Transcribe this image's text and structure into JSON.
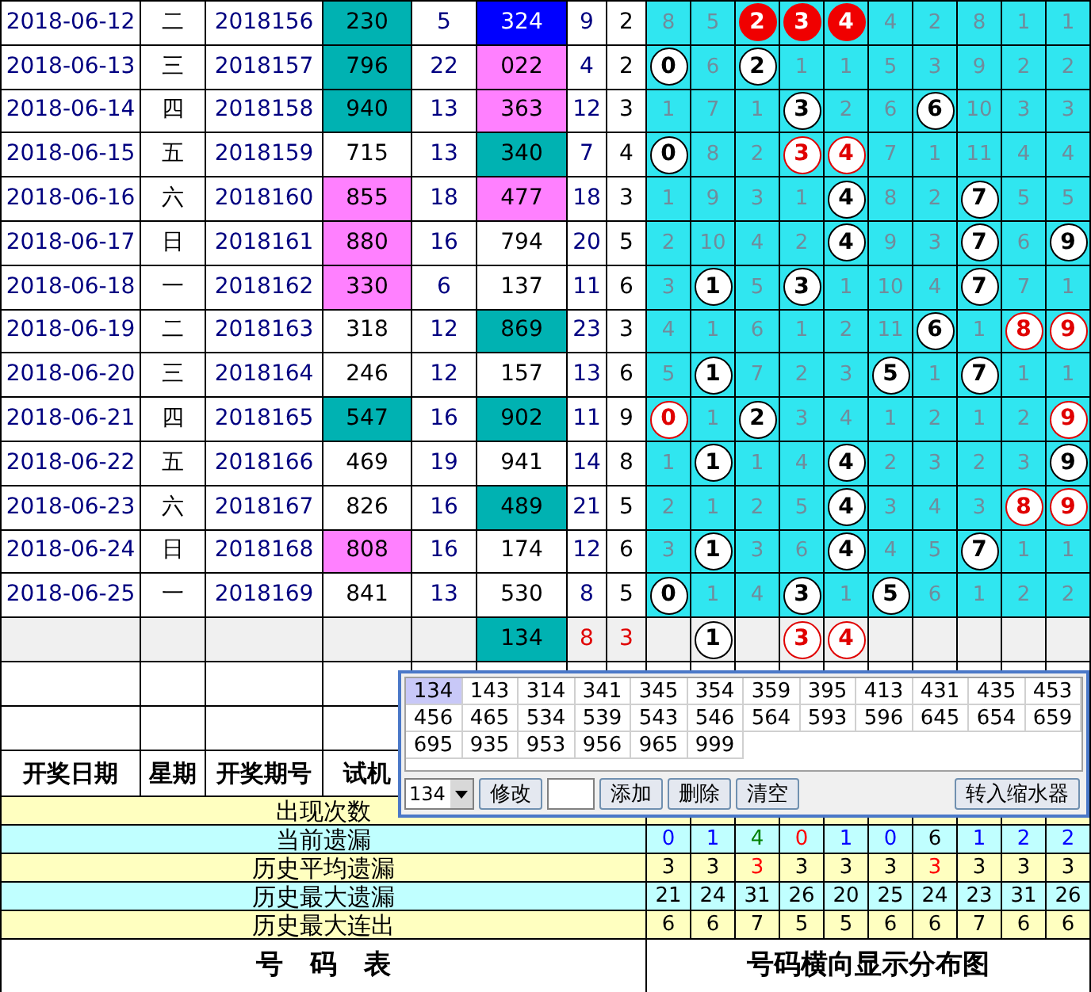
{
  "rows": [
    {
      "date": "2018-06-12",
      "weekday": "二",
      "issue": "2018156",
      "trial": {
        "value": "230",
        "color": "#00b2b2"
      },
      "sum": "5",
      "drawn": {
        "value": "324",
        "color": "#0000ff"
      },
      "span": "9",
      "tail": "2",
      "cells": [
        {
          "value": "8",
          "kind": "miss"
        },
        {
          "value": "5",
          "kind": "miss"
        },
        {
          "value": "2",
          "kind": "solid"
        },
        {
          "value": "3",
          "kind": "solid"
        },
        {
          "value": "4",
          "kind": "solid"
        },
        {
          "value": "4",
          "kind": "miss"
        },
        {
          "value": "2",
          "kind": "miss"
        },
        {
          "value": "8",
          "kind": "miss"
        },
        {
          "value": "1",
          "kind": "miss"
        },
        {
          "value": "1",
          "kind": "miss"
        }
      ]
    },
    {
      "date": "2018-06-13",
      "weekday": "三",
      "issue": "2018157",
      "trial": {
        "value": "796",
        "color": "#00b2b2"
      },
      "sum": "22",
      "drawn": {
        "value": "022",
        "color": "#ff80ff"
      },
      "span": "4",
      "tail": "2",
      "cells": [
        {
          "value": "0",
          "kind": "hit"
        },
        {
          "value": "6",
          "kind": "miss"
        },
        {
          "value": "2",
          "kind": "hit"
        },
        {
          "value": "1",
          "kind": "miss"
        },
        {
          "value": "1",
          "kind": "miss"
        },
        {
          "value": "5",
          "kind": "miss"
        },
        {
          "value": "3",
          "kind": "miss"
        },
        {
          "value": "9",
          "kind": "miss"
        },
        {
          "value": "2",
          "kind": "miss"
        },
        {
          "value": "2",
          "kind": "miss"
        }
      ]
    },
    {
      "date": "2018-06-14",
      "weekday": "四",
      "issue": "2018158",
      "trial": {
        "value": "940",
        "color": "#00b2b2"
      },
      "sum": "13",
      "drawn": {
        "value": "363",
        "color": "#ff80ff"
      },
      "span": "12",
      "tail": "3",
      "cells": [
        {
          "value": "1",
          "kind": "miss"
        },
        {
          "value": "7",
          "kind": "miss"
        },
        {
          "value": "1",
          "kind": "miss"
        },
        {
          "value": "3",
          "kind": "hit"
        },
        {
          "value": "2",
          "kind": "miss"
        },
        {
          "value": "6",
          "kind": "miss"
        },
        {
          "value": "6",
          "kind": "hit"
        },
        {
          "value": "10",
          "kind": "miss"
        },
        {
          "value": "3",
          "kind": "miss"
        },
        {
          "value": "3",
          "kind": "miss"
        }
      ]
    },
    {
      "date": "2018-06-15",
      "weekday": "五",
      "issue": "2018159",
      "trial": {
        "value": "715",
        "color": "#ffffff"
      },
      "sum": "13",
      "drawn": {
        "value": "340",
        "color": "#00b2b2"
      },
      "span": "7",
      "tail": "4",
      "cells": [
        {
          "value": "0",
          "kind": "hit"
        },
        {
          "value": "8",
          "kind": "miss"
        },
        {
          "value": "2",
          "kind": "miss"
        },
        {
          "value": "3",
          "kind": "red"
        },
        {
          "value": "4",
          "kind": "red"
        },
        {
          "value": "7",
          "kind": "miss"
        },
        {
          "value": "1",
          "kind": "miss"
        },
        {
          "value": "11",
          "kind": "miss"
        },
        {
          "value": "4",
          "kind": "miss"
        },
        {
          "value": "4",
          "kind": "miss"
        }
      ]
    },
    {
      "date": "2018-06-16",
      "weekday": "六",
      "issue": "2018160",
      "trial": {
        "value": "855",
        "color": "#ff80ff"
      },
      "sum": "18",
      "drawn": {
        "value": "477",
        "color": "#ff80ff"
      },
      "span": "18",
      "tail": "3",
      "cells": [
        {
          "value": "1",
          "kind": "miss"
        },
        {
          "value": "9",
          "kind": "miss"
        },
        {
          "value": "3",
          "kind": "miss"
        },
        {
          "value": "1",
          "kind": "miss"
        },
        {
          "value": "4",
          "kind": "hit"
        },
        {
          "value": "8",
          "kind": "miss"
        },
        {
          "value": "2",
          "kind": "miss"
        },
        {
          "value": "7",
          "kind": "hit"
        },
        {
          "value": "5",
          "kind": "miss"
        },
        {
          "value": "5",
          "kind": "miss"
        }
      ]
    },
    {
      "date": "2018-06-17",
      "weekday": "日",
      "issue": "2018161",
      "trial": {
        "value": "880",
        "color": "#ff80ff"
      },
      "sum": "16",
      "drawn": {
        "value": "794",
        "color": "#ffffff"
      },
      "span": "20",
      "tail": "5",
      "cells": [
        {
          "value": "2",
          "kind": "miss"
        },
        {
          "value": "10",
          "kind": "miss"
        },
        {
          "value": "4",
          "kind": "miss"
        },
        {
          "value": "2",
          "kind": "miss"
        },
        {
          "value": "4",
          "kind": "hit"
        },
        {
          "value": "9",
          "kind": "miss"
        },
        {
          "value": "3",
          "kind": "miss"
        },
        {
          "value": "7",
          "kind": "hit"
        },
        {
          "value": "6",
          "kind": "miss"
        },
        {
          "value": "9",
          "kind": "hit"
        }
      ]
    },
    {
      "date": "2018-06-18",
      "weekday": "一",
      "issue": "2018162",
      "trial": {
        "value": "330",
        "color": "#ff80ff"
      },
      "sum": "6",
      "drawn": {
        "value": "137",
        "color": "#ffffff"
      },
      "span": "11",
      "tail": "6",
      "cells": [
        {
          "value": "3",
          "kind": "miss"
        },
        {
          "value": "1",
          "kind": "hit"
        },
        {
          "value": "5",
          "kind": "miss"
        },
        {
          "value": "3",
          "kind": "hit"
        },
        {
          "value": "1",
          "kind": "miss"
        },
        {
          "value": "10",
          "kind": "miss"
        },
        {
          "value": "4",
          "kind": "miss"
        },
        {
          "value": "7",
          "kind": "hit"
        },
        {
          "value": "7",
          "kind": "miss"
        },
        {
          "value": "1",
          "kind": "miss"
        }
      ]
    },
    {
      "date": "2018-06-19",
      "weekday": "二",
      "issue": "2018163",
      "trial": {
        "value": "318",
        "color": "#ffffff"
      },
      "sum": "12",
      "drawn": {
        "value": "869",
        "color": "#00b2b2"
      },
      "span": "23",
      "tail": "3",
      "cells": [
        {
          "value": "4",
          "kind": "miss"
        },
        {
          "value": "1",
          "kind": "miss"
        },
        {
          "value": "6",
          "kind": "miss"
        },
        {
          "value": "1",
          "kind": "miss"
        },
        {
          "value": "2",
          "kind": "miss"
        },
        {
          "value": "11",
          "kind": "miss"
        },
        {
          "value": "6",
          "kind": "hit"
        },
        {
          "value": "1",
          "kind": "miss"
        },
        {
          "value": "8",
          "kind": "red"
        },
        {
          "value": "9",
          "kind": "red"
        }
      ]
    },
    {
      "date": "2018-06-20",
      "weekday": "三",
      "issue": "2018164",
      "trial": {
        "value": "246",
        "color": "#ffffff"
      },
      "sum": "12",
      "drawn": {
        "value": "157",
        "color": "#ffffff"
      },
      "span": "13",
      "tail": "6",
      "cells": [
        {
          "value": "5",
          "kind": "miss"
        },
        {
          "value": "1",
          "kind": "hit"
        },
        {
          "value": "7",
          "kind": "miss"
        },
        {
          "value": "2",
          "kind": "miss"
        },
        {
          "value": "3",
          "kind": "miss"
        },
        {
          "value": "5",
          "kind": "hit"
        },
        {
          "value": "1",
          "kind": "miss"
        },
        {
          "value": "7",
          "kind": "hit"
        },
        {
          "value": "1",
          "kind": "miss"
        },
        {
          "value": "1",
          "kind": "miss"
        }
      ]
    },
    {
      "date": "2018-06-21",
      "weekday": "四",
      "issue": "2018165",
      "trial": {
        "value": "547",
        "color": "#00b2b2"
      },
      "sum": "16",
      "drawn": {
        "value": "902",
        "color": "#00b2b2"
      },
      "span": "11",
      "tail": "9",
      "cells": [
        {
          "value": "0",
          "kind": "red"
        },
        {
          "value": "1",
          "kind": "miss"
        },
        {
          "value": "2",
          "kind": "hit"
        },
        {
          "value": "3",
          "kind": "miss"
        },
        {
          "value": "4",
          "kind": "miss"
        },
        {
          "value": "1",
          "kind": "miss"
        },
        {
          "value": "2",
          "kind": "miss"
        },
        {
          "value": "1",
          "kind": "miss"
        },
        {
          "value": "2",
          "kind": "miss"
        },
        {
          "value": "9",
          "kind": "red"
        }
      ]
    },
    {
      "date": "2018-06-22",
      "weekday": "五",
      "issue": "2018166",
      "trial": {
        "value": "469",
        "color": "#ffffff"
      },
      "sum": "19",
      "drawn": {
        "value": "941",
        "color": "#ffffff"
      },
      "span": "14",
      "tail": "8",
      "cells": [
        {
          "value": "1",
          "kind": "miss"
        },
        {
          "value": "1",
          "kind": "hit"
        },
        {
          "value": "1",
          "kind": "miss"
        },
        {
          "value": "4",
          "kind": "miss"
        },
        {
          "value": "4",
          "kind": "hit"
        },
        {
          "value": "2",
          "kind": "miss"
        },
        {
          "value": "3",
          "kind": "miss"
        },
        {
          "value": "2",
          "kind": "miss"
        },
        {
          "value": "3",
          "kind": "miss"
        },
        {
          "value": "9",
          "kind": "hit"
        }
      ]
    },
    {
      "date": "2018-06-23",
      "weekday": "六",
      "issue": "2018167",
      "trial": {
        "value": "826",
        "color": "#ffffff"
      },
      "sum": "16",
      "drawn": {
        "value": "489",
        "color": "#00b2b2"
      },
      "span": "21",
      "tail": "5",
      "cells": [
        {
          "value": "2",
          "kind": "miss"
        },
        {
          "value": "1",
          "kind": "miss"
        },
        {
          "value": "2",
          "kind": "miss"
        },
        {
          "value": "5",
          "kind": "miss"
        },
        {
          "value": "4",
          "kind": "hit"
        },
        {
          "value": "3",
          "kind": "miss"
        },
        {
          "value": "4",
          "kind": "miss"
        },
        {
          "value": "3",
          "kind": "miss"
        },
        {
          "value": "8",
          "kind": "red"
        },
        {
          "value": "9",
          "kind": "red"
        }
      ]
    },
    {
      "date": "2018-06-24",
      "weekday": "日",
      "issue": "2018168",
      "trial": {
        "value": "808",
        "color": "#ff80ff"
      },
      "sum": "16",
      "drawn": {
        "value": "174",
        "color": "#ffffff"
      },
      "span": "12",
      "tail": "6",
      "cells": [
        {
          "value": "3",
          "kind": "miss"
        },
        {
          "value": "1",
          "kind": "hit"
        },
        {
          "value": "3",
          "kind": "miss"
        },
        {
          "value": "6",
          "kind": "miss"
        },
        {
          "value": "4",
          "kind": "hit"
        },
        {
          "value": "4",
          "kind": "miss"
        },
        {
          "value": "5",
          "kind": "miss"
        },
        {
          "value": "7",
          "kind": "hit"
        },
        {
          "value": "1",
          "kind": "miss"
        },
        {
          "value": "1",
          "kind": "miss"
        }
      ]
    },
    {
      "date": "2018-06-25",
      "weekday": "一",
      "issue": "2018169",
      "trial": {
        "value": "841",
        "color": "#ffffff"
      },
      "sum": "13",
      "drawn": {
        "value": "530",
        "color": "#ffffff"
      },
      "span": "8",
      "tail": "5",
      "cells": [
        {
          "value": "0",
          "kind": "hit"
        },
        {
          "value": "1",
          "kind": "miss"
        },
        {
          "value": "4",
          "kind": "miss"
        },
        {
          "value": "3",
          "kind": "hit"
        },
        {
          "value": "1",
          "kind": "miss"
        },
        {
          "value": "5",
          "kind": "hit"
        },
        {
          "value": "6",
          "kind": "miss"
        },
        {
          "value": "1",
          "kind": "miss"
        },
        {
          "value": "2",
          "kind": "miss"
        },
        {
          "value": "2",
          "kind": "miss"
        }
      ]
    }
  ],
  "forecast": {
    "drawn": {
      "value": "134",
      "color": "#00b2b2"
    },
    "span": "8",
    "tail": "3",
    "cells": [
      {
        "kind": "blank"
      },
      {
        "value": "1",
        "kind": "hit"
      },
      {
        "kind": "blank"
      },
      {
        "value": "3",
        "kind": "red"
      },
      {
        "value": "4",
        "kind": "red"
      },
      {
        "kind": "blank"
      },
      {
        "kind": "blank"
      },
      {
        "kind": "blank"
      },
      {
        "kind": "blank"
      },
      {
        "kind": "blank"
      }
    ]
  },
  "header": [
    "开奖日期",
    "星期",
    "开奖期号",
    "试机"
  ],
  "stats": [
    {
      "label": "出现次数"
    },
    {
      "label": "当前遗漏",
      "values": [
        {
          "value": "0",
          "color": "#0000ff"
        },
        {
          "value": "1",
          "color": "#0000ff"
        },
        {
          "value": "4",
          "color": "#008000"
        },
        {
          "value": "0",
          "color": "#ff0000"
        },
        {
          "value": "1",
          "color": "#0000ff"
        },
        {
          "value": "0",
          "color": "#0000ff"
        },
        {
          "value": "6",
          "color": "#000000"
        },
        {
          "value": "1",
          "color": "#0000ff"
        },
        {
          "value": "2",
          "color": "#0000ff"
        },
        {
          "value": "2",
          "color": "#0000ff"
        }
      ]
    },
    {
      "label": "历史平均遗漏",
      "values": [
        {
          "value": "3",
          "color": "#000000"
        },
        {
          "value": "3",
          "color": "#000000"
        },
        {
          "value": "3",
          "color": "#ff0000"
        },
        {
          "value": "3",
          "color": "#000000"
        },
        {
          "value": "3",
          "color": "#000000"
        },
        {
          "value": "3",
          "color": "#000000"
        },
        {
          "value": "3",
          "color": "#ff0000"
        },
        {
          "value": "3",
          "color": "#000000"
        },
        {
          "value": "3",
          "color": "#000000"
        },
        {
          "value": "3",
          "color": "#000000"
        }
      ]
    },
    {
      "label": "历史最大遗漏",
      "values": [
        {
          "value": "21",
          "color": "#000000"
        },
        {
          "value": "24",
          "color": "#000000"
        },
        {
          "value": "31",
          "color": "#000000"
        },
        {
          "value": "26",
          "color": "#000000"
        },
        {
          "value": "20",
          "color": "#000000"
        },
        {
          "value": "25",
          "color": "#000000"
        },
        {
          "value": "24",
          "color": "#000000"
        },
        {
          "value": "23",
          "color": "#000000"
        },
        {
          "value": "31",
          "color": "#000000"
        },
        {
          "value": "26",
          "color": "#000000"
        }
      ]
    },
    {
      "label": "历史最大连出",
      "values": [
        {
          "value": "6",
          "color": "#000000"
        },
        {
          "value": "6",
          "color": "#000000"
        },
        {
          "value": "7",
          "color": "#000000"
        },
        {
          "value": "5",
          "color": "#000000"
        },
        {
          "value": "5",
          "color": "#000000"
        },
        {
          "value": "6",
          "color": "#000000"
        },
        {
          "value": "6",
          "color": "#000000"
        },
        {
          "value": "7",
          "color": "#000000"
        },
        {
          "value": "6",
          "color": "#000000"
        },
        {
          "value": "6",
          "color": "#000000"
        }
      ]
    }
  ],
  "footer": [
    "号　码　表",
    "号码横向显示分布图"
  ],
  "popup": {
    "numbers": [
      {
        "value": "134",
        "selected": true
      },
      {
        "value": "143",
        "selected": false
      },
      {
        "value": "314",
        "selected": false
      },
      {
        "value": "341",
        "selected": false
      },
      {
        "value": "345",
        "selected": false
      },
      {
        "value": "354",
        "selected": false
      },
      {
        "value": "359",
        "selected": false
      },
      {
        "value": "395",
        "selected": false
      },
      {
        "value": "413",
        "selected": false
      },
      {
        "value": "431",
        "selected": false
      },
      {
        "value": "435",
        "selected": false
      },
      {
        "value": "453",
        "selected": false
      },
      {
        "value": "456",
        "selected": false
      },
      {
        "value": "465",
        "selected": false
      },
      {
        "value": "534",
        "selected": false
      },
      {
        "value": "539",
        "selected": false
      },
      {
        "value": "543",
        "selected": false
      },
      {
        "value": "546",
        "selected": false
      },
      {
        "value": "564",
        "selected": false
      },
      {
        "value": "593",
        "selected": false
      },
      {
        "value": "596",
        "selected": false
      },
      {
        "value": "645",
        "selected": false
      },
      {
        "value": "654",
        "selected": false
      },
      {
        "value": "659",
        "selected": false
      },
      {
        "value": "695",
        "selected": false
      },
      {
        "value": "935",
        "selected": false
      },
      {
        "value": "953",
        "selected": false
      },
      {
        "value": "956",
        "selected": false
      },
      {
        "value": "965",
        "selected": false
      },
      {
        "value": "999",
        "selected": false
      }
    ],
    "combo": "134",
    "buttons": [
      "修改",
      "添加",
      "删除",
      "清空"
    ],
    "transfer_button": "转入缩水器"
  }
}
